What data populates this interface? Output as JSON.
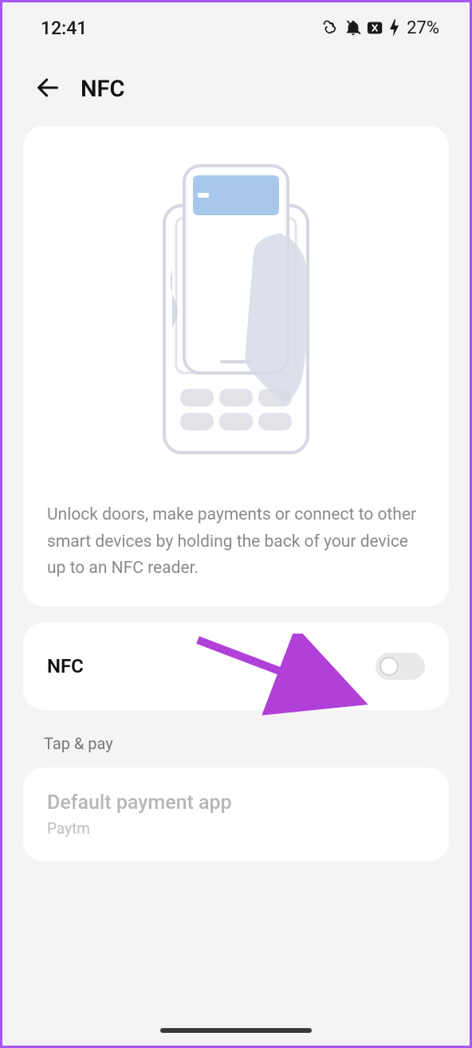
{
  "status": {
    "time": "12:41",
    "battery_pct": "27%"
  },
  "header": {
    "title": "NFC"
  },
  "hero": {
    "description": "Unlock doors, make payments or connect to other smart devices by holding the back of your device up to an NFC reader."
  },
  "nfc_toggle": {
    "label": "NFC",
    "enabled": false
  },
  "tap_pay": {
    "section_label": "Tap & pay",
    "title": "Default payment app",
    "subtitle": "Paytm"
  }
}
